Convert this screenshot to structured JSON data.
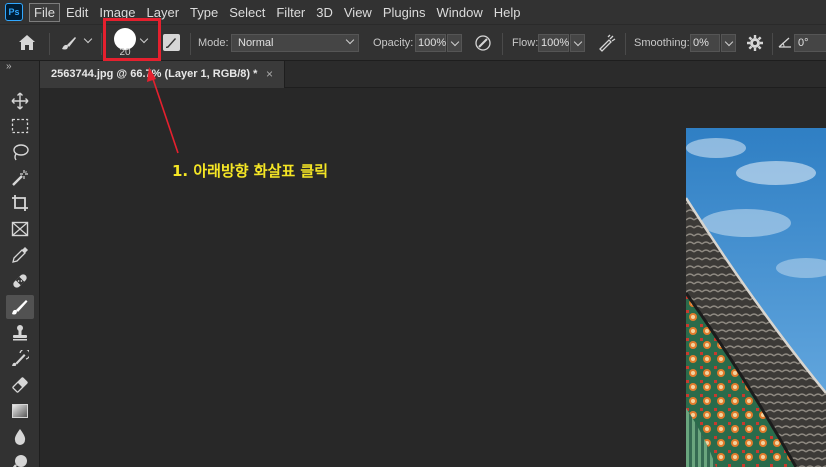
{
  "app": {
    "logo": "Ps"
  },
  "menu": [
    "File",
    "Edit",
    "Image",
    "Layer",
    "Type",
    "Select",
    "Filter",
    "3D",
    "View",
    "Plugins",
    "Window",
    "Help"
  ],
  "options": {
    "brush_size": "20",
    "mode_label": "Mode:",
    "mode_value": "Normal",
    "opacity_label": "Opacity:",
    "opacity_value": "100%",
    "flow_label": "Flow:",
    "flow_value": "100%",
    "smoothing_label": "Smoothing:",
    "smoothing_value": "0%",
    "angle_value": "0°"
  },
  "document": {
    "tab_title": "2563744.jpg @ 66.7% (Layer 1, RGB/8) *",
    "close_glyph": "×"
  },
  "toolbar": {
    "collapse_glyph": "»",
    "tools": [
      "move-tool",
      "marquee-tool",
      "lasso-tool",
      "magic-wand-tool",
      "crop-tool",
      "frame-tool",
      "eyedropper-tool",
      "healing-brush-tool",
      "brush-tool",
      "clone-stamp-tool",
      "history-brush-tool",
      "eraser-tool",
      "gradient-tool",
      "blur-tool",
      "dodge-tool"
    ],
    "selected_tool": "brush-tool"
  },
  "annotation": {
    "text": "1. 아래방향 화살표 클릭",
    "color": "#f5e625",
    "highlight_color": "#e5202e"
  },
  "colors": {
    "accent": "#31a8ff",
    "panel": "#323232",
    "canvas": "#282828"
  }
}
